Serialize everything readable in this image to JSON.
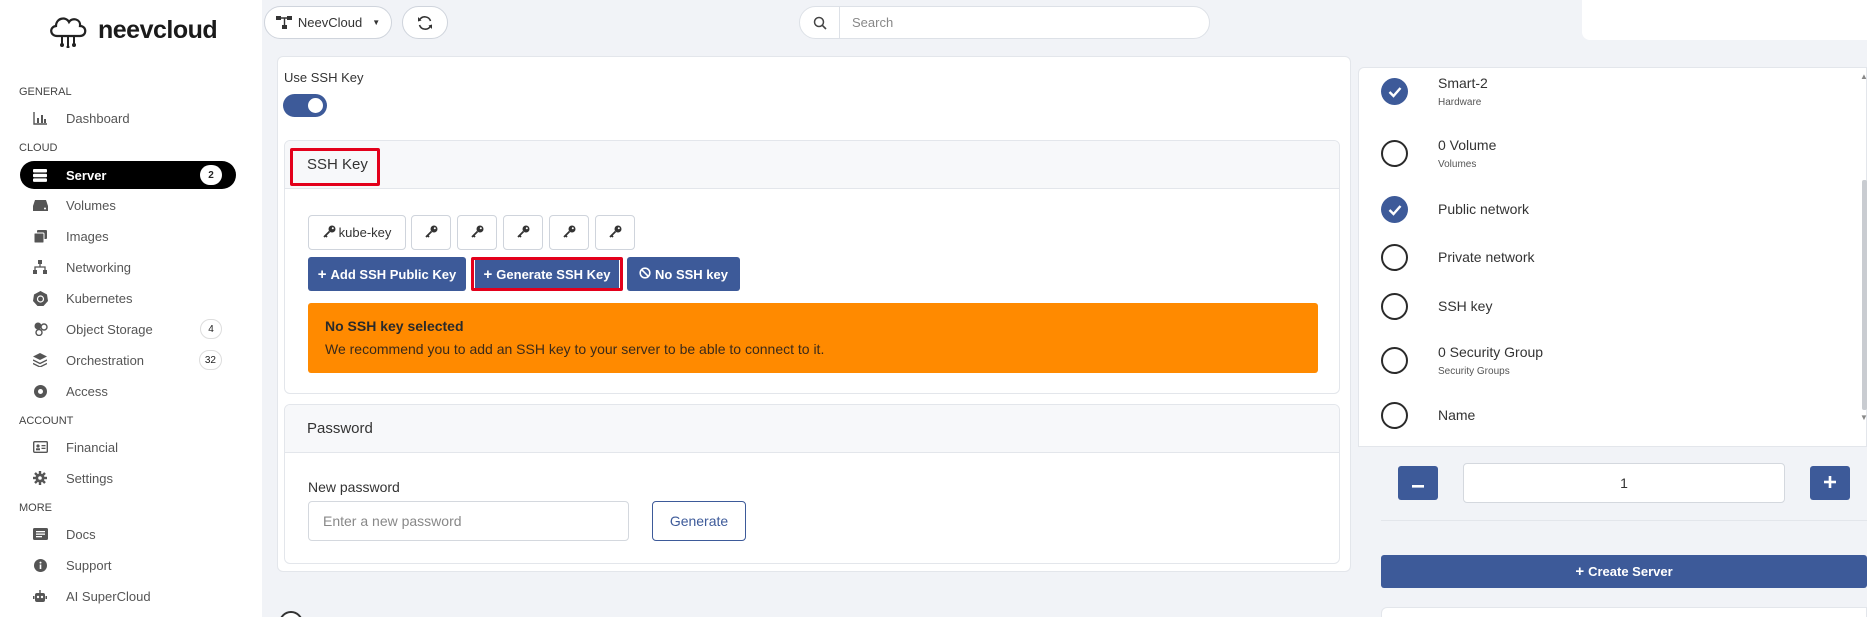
{
  "brand": {
    "name": "neevcloud"
  },
  "sidebar": {
    "sections": {
      "general": "GENERAL",
      "cloud": "CLOUD",
      "account": "ACCOUNT",
      "more": "MORE"
    },
    "items": {
      "dashboard": {
        "label": "Dashboard",
        "icon": "chart-icon"
      },
      "server": {
        "label": "Server",
        "badge": "2",
        "icon": "server-icon"
      },
      "volumes": {
        "label": "Volumes",
        "icon": "disk-icon"
      },
      "images": {
        "label": "Images",
        "icon": "images-icon"
      },
      "networking": {
        "label": "Networking",
        "icon": "network-icon"
      },
      "kubernetes": {
        "label": "Kubernetes",
        "icon": "kubernetes-icon"
      },
      "object_storage": {
        "label": "Object Storage",
        "badge": "4",
        "icon": "object-storage-icon"
      },
      "orchestration": {
        "label": "Orchestration",
        "badge": "32",
        "icon": "layers-icon"
      },
      "access": {
        "label": "Access",
        "icon": "access-icon"
      },
      "financial": {
        "label": "Financial",
        "icon": "id-card-icon"
      },
      "settings": {
        "label": "Settings",
        "icon": "gear-icon"
      },
      "docs": {
        "label": "Docs",
        "icon": "docs-icon"
      },
      "support": {
        "label": "Support",
        "icon": "info-icon"
      },
      "ai_supercloud": {
        "label": "AI SuperCloud",
        "icon": "robot-icon"
      }
    }
  },
  "topbar": {
    "project": "NeevCloud",
    "search_placeholder": "Search"
  },
  "ssh": {
    "toggle_label": "Use SSH Key",
    "toggle_on": true,
    "card_title": "SSH Key",
    "keys": [
      "kube-key"
    ],
    "add_label": "Add SSH Public Key",
    "generate_label": "Generate SSH Key",
    "none_label": "No SSH key",
    "alert_title": "No SSH key selected",
    "alert_text": "We recommend you to add an SSH key to your server to be able to connect to it."
  },
  "password": {
    "card_title": "Password",
    "field_label": "New password",
    "placeholder": "Enter a new password",
    "generate_label": "Generate"
  },
  "summary": {
    "items": [
      {
        "title": "Smart-2",
        "subtitle": "Hardware",
        "checked": true
      },
      {
        "title": "0 Volume",
        "subtitle": "Volumes",
        "checked": false
      },
      {
        "title": "Public network",
        "subtitle": "",
        "checked": true
      },
      {
        "title": "Private network",
        "subtitle": "",
        "checked": false
      },
      {
        "title": "SSH key",
        "subtitle": "",
        "checked": false
      },
      {
        "title": "0 Security Group",
        "subtitle": "Security Groups",
        "checked": false
      },
      {
        "title": "Name",
        "subtitle": "",
        "checked": false
      }
    ],
    "quantity": "1",
    "create_label": "Create Server"
  },
  "colors": {
    "primary": "#3d5a99",
    "warning": "#ff8a00",
    "highlight": "#e3001b",
    "active_nav": "#000000"
  }
}
